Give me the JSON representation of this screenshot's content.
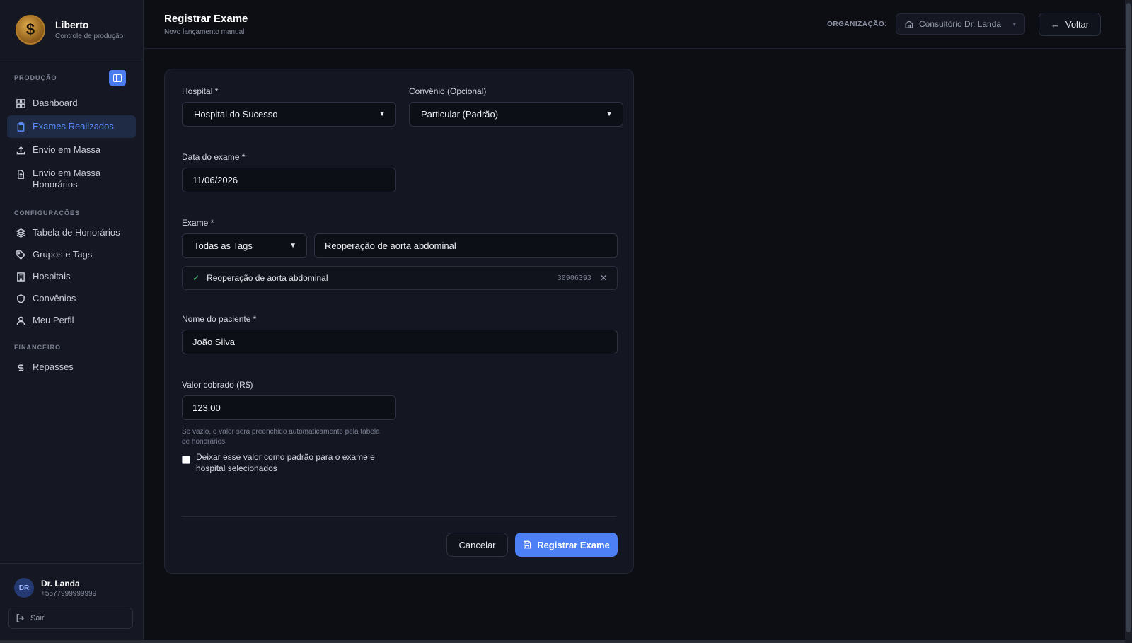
{
  "brand": {
    "name": "Liberto",
    "subtitle": "Controle de produção"
  },
  "sidebar": {
    "sections": {
      "producao": "PRODUÇÃO",
      "configuracoes": "CONFIGURAÇÕES",
      "financeiro": "FINANCEIRO"
    },
    "items": [
      {
        "label": "Dashboard",
        "icon": "grid-icon"
      },
      {
        "label": "Exames Realizados",
        "icon": "clipboard-icon",
        "active": true
      },
      {
        "label": "Envio em Massa",
        "icon": "upload-icon"
      },
      {
        "label": "Envio em Massa Honorários",
        "icon": "file-upload-icon"
      },
      {
        "label": "Tabela de Honorários",
        "icon": "layers-icon"
      },
      {
        "label": "Grupos e Tags",
        "icon": "tag-icon"
      },
      {
        "label": "Hospitais",
        "icon": "building-icon"
      },
      {
        "label": "Convênios",
        "icon": "shield-icon"
      },
      {
        "label": "Meu Perfil",
        "icon": "user-icon"
      },
      {
        "label": "Repasses",
        "icon": "dollar-icon"
      }
    ],
    "user": {
      "initials": "DR",
      "name": "Dr. Landa",
      "phone": "+5577999999999"
    },
    "logout_label": "Sair"
  },
  "header": {
    "title": "Registrar Exame",
    "subtitle": "Novo lançamento manual",
    "org_label": "ORGANIZAÇÃO:",
    "org_value": "Consultório Dr. Landa",
    "back_label": "Voltar"
  },
  "form": {
    "hospital": {
      "label": "Hospital *",
      "value": "Hospital do Sucesso"
    },
    "convenio": {
      "label": "Convênio (Opcional)",
      "value": "Particular (Padrão)"
    },
    "data": {
      "label": "Data do exame *",
      "value": "11/06/2026"
    },
    "exame": {
      "label": "Exame *",
      "tag_filter": "Todas as Tags",
      "search_value": "Reoperação de aorta abdominal",
      "selected_name": "Reoperação de aorta abdominal",
      "selected_code": "30906393"
    },
    "paciente": {
      "label": "Nome do paciente *",
      "value": "João Silva"
    },
    "valor": {
      "label": "Valor cobrado (R$)",
      "value": "123.00",
      "hint": "Se vazio, o valor será preenchido automaticamente pela tabela de honorários."
    },
    "default_checkbox_label": "Deixar esse valor como padrão para o exame e hospital selecionados",
    "cancel_label": "Cancelar",
    "submit_label": "Registrar Exame"
  },
  "colors": {
    "accent": "#4d7ff5",
    "background": "#0c0e14",
    "success": "#3fbf6b"
  }
}
